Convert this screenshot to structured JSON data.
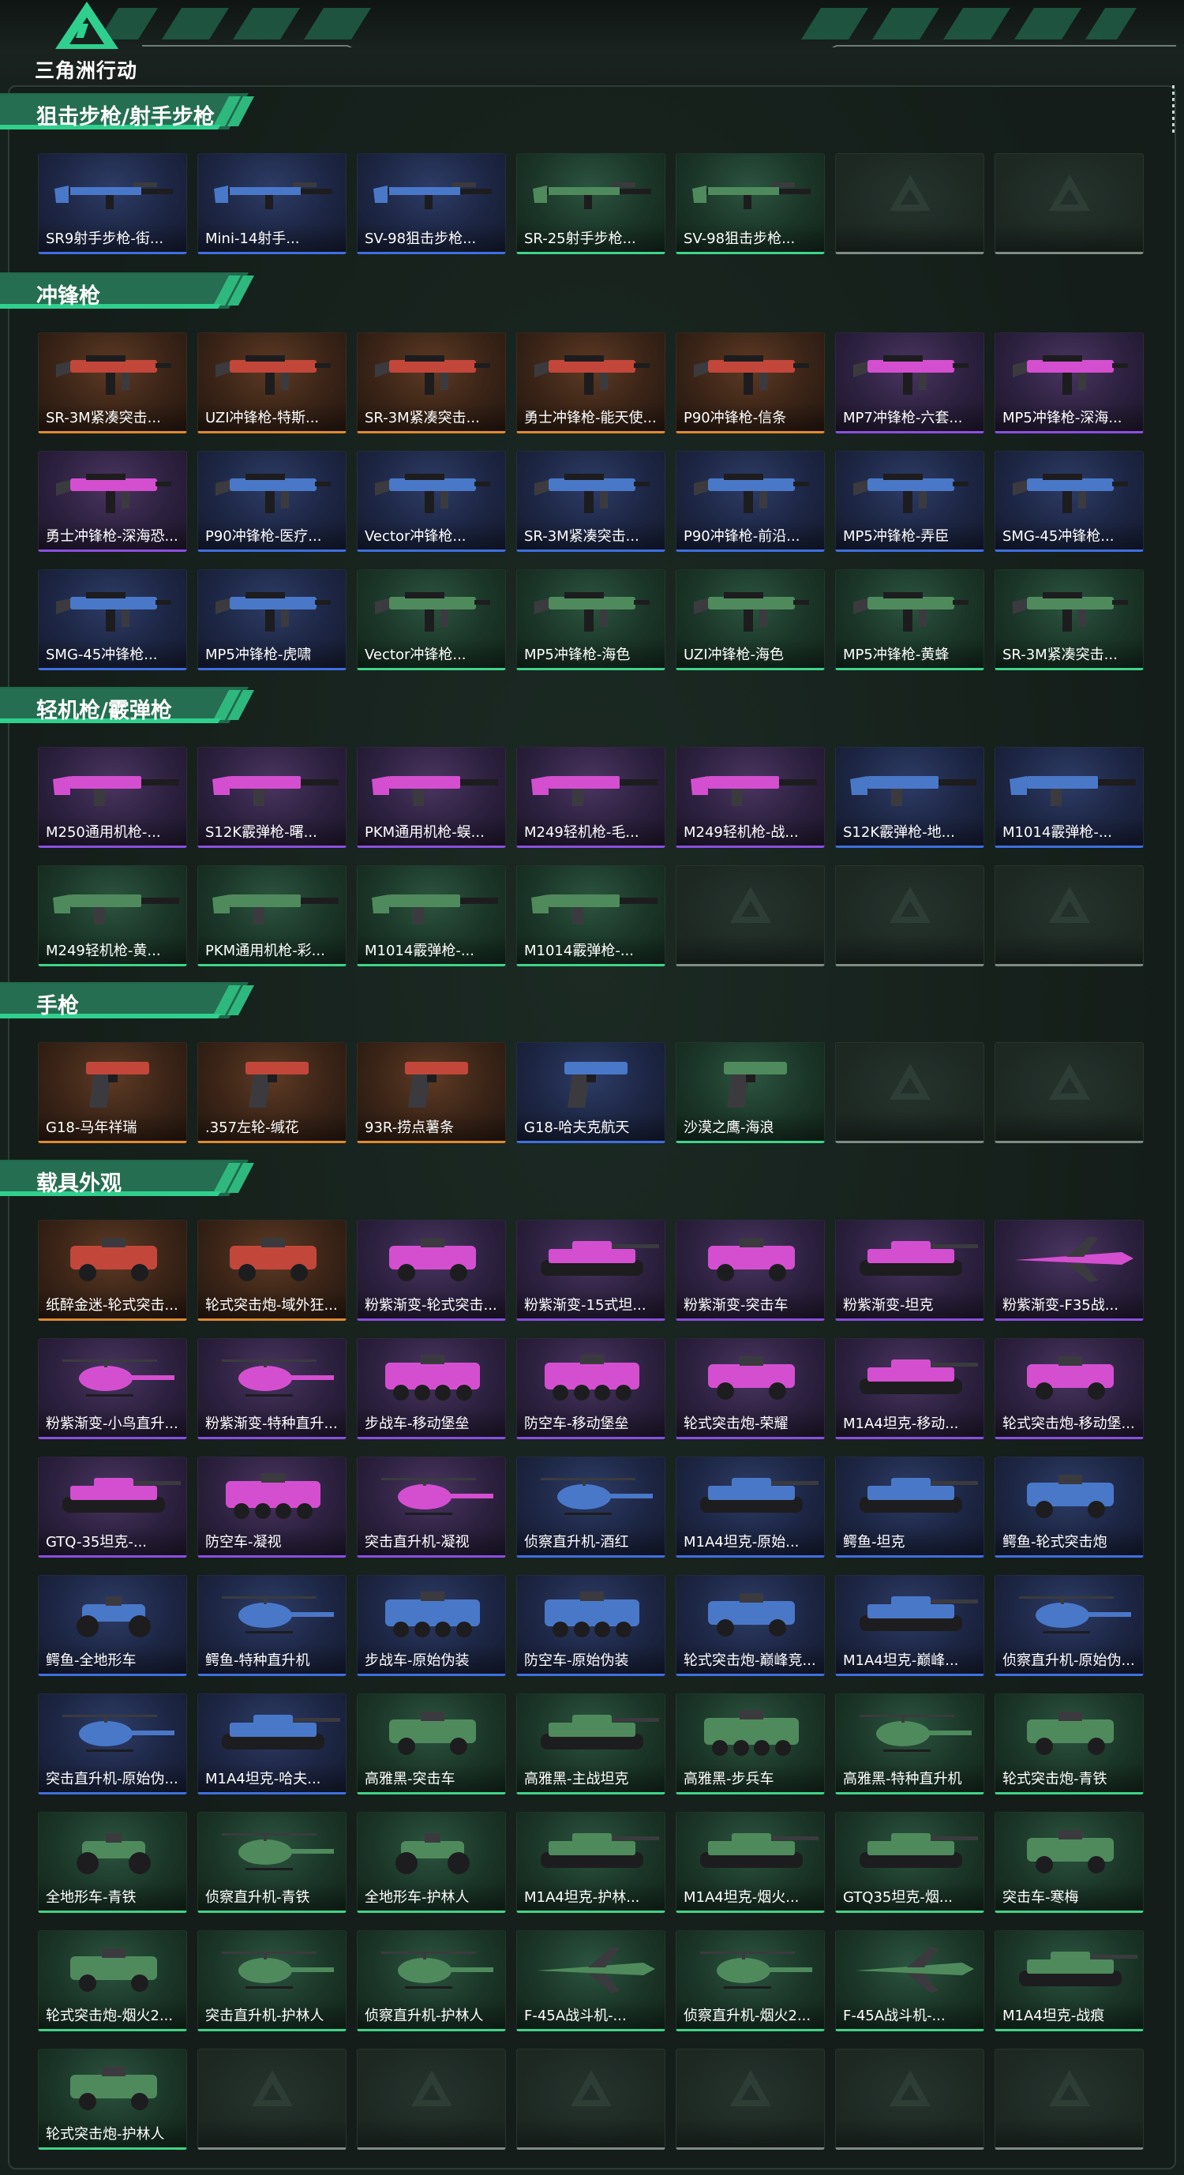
{
  "logo_text": "三角洲行动",
  "rarity_colors": {
    "gold": "#e08a2e",
    "purple": "#8b4fe0",
    "blue": "#3f6fe0",
    "green": "#3fd48a",
    "empty": "#7f8c86"
  },
  "sections": [
    {
      "title": "狙击步枪/射手步枪",
      "items": [
        {
          "label": "SR9射手步枪-街...",
          "rarity": "blue",
          "icon": "rifle-icon"
        },
        {
          "label": "Mini-14射手...",
          "rarity": "blue",
          "icon": "rifle-icon"
        },
        {
          "label": "SV-98狙击步枪...",
          "rarity": "blue",
          "icon": "sniper-rifle-icon"
        },
        {
          "label": "SR-25射手步枪...",
          "rarity": "green",
          "icon": "rifle-icon"
        },
        {
          "label": "SV-98狙击步枪...",
          "rarity": "green",
          "icon": "sniper-rifle-icon"
        },
        {
          "label": "",
          "rarity": "empty",
          "icon": "empty-slot-icon"
        },
        {
          "label": "",
          "rarity": "empty",
          "icon": "empty-slot-icon"
        }
      ]
    },
    {
      "title": "冲锋枪",
      "items": [
        {
          "label": "SR-3M紧凑突击...",
          "rarity": "gold",
          "icon": "smg-icon"
        },
        {
          "label": "UZI冲锋枪-特斯...",
          "rarity": "gold",
          "icon": "smg-icon"
        },
        {
          "label": "SR-3M紧凑突击...",
          "rarity": "gold",
          "icon": "smg-icon"
        },
        {
          "label": "勇士冲锋枪-能天使...",
          "rarity": "gold",
          "icon": "smg-icon"
        },
        {
          "label": "P90冲锋枪-信条",
          "rarity": "gold",
          "icon": "smg-icon"
        },
        {
          "label": "MP7冲锋枪-六套...",
          "rarity": "purple",
          "icon": "smg-icon"
        },
        {
          "label": "MP5冲锋枪-深海...",
          "rarity": "purple",
          "icon": "smg-icon"
        },
        {
          "label": "勇士冲锋枪-深海恐...",
          "rarity": "purple",
          "icon": "smg-icon"
        },
        {
          "label": "P90冲锋枪-医疗...",
          "rarity": "blue",
          "icon": "smg-icon"
        },
        {
          "label": "Vector冲锋枪...",
          "rarity": "blue",
          "icon": "smg-icon"
        },
        {
          "label": "SR-3M紧凑突击...",
          "rarity": "blue",
          "icon": "smg-icon"
        },
        {
          "label": "P90冲锋枪-前沿...",
          "rarity": "blue",
          "icon": "smg-icon"
        },
        {
          "label": "MP5冲锋枪-弄臣",
          "rarity": "blue",
          "icon": "smg-icon"
        },
        {
          "label": "SMG-45冲锋枪...",
          "rarity": "blue",
          "icon": "smg-icon"
        },
        {
          "label": "SMG-45冲锋枪...",
          "rarity": "blue",
          "icon": "smg-icon"
        },
        {
          "label": "MP5冲锋枪-虎啸",
          "rarity": "blue",
          "icon": "smg-icon"
        },
        {
          "label": "Vector冲锋枪...",
          "rarity": "green",
          "icon": "smg-icon"
        },
        {
          "label": "MP5冲锋枪-海色",
          "rarity": "green",
          "icon": "smg-icon"
        },
        {
          "label": "UZI冲锋枪-海色",
          "rarity": "green",
          "icon": "smg-icon"
        },
        {
          "label": "MP5冲锋枪-黄蜂",
          "rarity": "green",
          "icon": "smg-icon"
        },
        {
          "label": "SR-3M紧凑突击...",
          "rarity": "green",
          "icon": "smg-icon"
        }
      ]
    },
    {
      "title": "轻机枪/霰弹枪",
      "items": [
        {
          "label": "M250通用机枪-...",
          "rarity": "purple",
          "icon": "machine-gun-icon"
        },
        {
          "label": "S12K霰弹枪-曙...",
          "rarity": "purple",
          "icon": "shotgun-icon"
        },
        {
          "label": "PKM通用机枪-蜈...",
          "rarity": "purple",
          "icon": "machine-gun-icon"
        },
        {
          "label": "M249轻机枪-毛...",
          "rarity": "purple",
          "icon": "machine-gun-icon"
        },
        {
          "label": "M249轻机枪-战...",
          "rarity": "purple",
          "icon": "machine-gun-icon"
        },
        {
          "label": "S12K霰弹枪-地...",
          "rarity": "blue",
          "icon": "shotgun-icon"
        },
        {
          "label": "M1014霰弹枪-...",
          "rarity": "blue",
          "icon": "shotgun-icon"
        },
        {
          "label": "M249轻机枪-黄...",
          "rarity": "green",
          "icon": "machine-gun-icon"
        },
        {
          "label": "PKM通用机枪-彩...",
          "rarity": "green",
          "icon": "machine-gun-icon"
        },
        {
          "label": "M1014霰弹枪-...",
          "rarity": "green",
          "icon": "shotgun-icon"
        },
        {
          "label": "M1014霰弹枪-...",
          "rarity": "green",
          "icon": "shotgun-icon"
        },
        {
          "label": "",
          "rarity": "empty",
          "icon": "empty-slot-icon"
        },
        {
          "label": "",
          "rarity": "empty",
          "icon": "empty-slot-icon"
        },
        {
          "label": "",
          "rarity": "empty",
          "icon": "empty-slot-icon"
        }
      ]
    },
    {
      "title": "手枪",
      "items": [
        {
          "label": "G18-马年祥瑞",
          "rarity": "gold",
          "icon": "pistol-icon"
        },
        {
          "label": ".357左轮-缄花",
          "rarity": "gold",
          "icon": "revolver-icon"
        },
        {
          "label": "93R-捞点薯条",
          "rarity": "gold",
          "icon": "pistol-icon"
        },
        {
          "label": "G18-哈夫克航天",
          "rarity": "blue",
          "icon": "pistol-icon"
        },
        {
          "label": "沙漠之鹰-海浪",
          "rarity": "green",
          "icon": "pistol-icon"
        },
        {
          "label": "",
          "rarity": "empty",
          "icon": "empty-slot-icon"
        },
        {
          "label": "",
          "rarity": "empty",
          "icon": "empty-slot-icon"
        }
      ]
    },
    {
      "title": "载具外观",
      "items": [
        {
          "label": "纸醉金迷-轮式突击...",
          "rarity": "gold",
          "icon": "armored-car-icon"
        },
        {
          "label": "轮式突击炮-域外狂...",
          "rarity": "gold",
          "icon": "armored-car-icon"
        },
        {
          "label": "粉紫渐变-轮式突击...",
          "rarity": "purple",
          "icon": "armored-car-icon"
        },
        {
          "label": "粉紫渐变-15式坦...",
          "rarity": "purple",
          "icon": "tank-icon"
        },
        {
          "label": "粉紫渐变-突击车",
          "rarity": "purple",
          "icon": "armored-car-icon"
        },
        {
          "label": "粉紫渐变-坦克",
          "rarity": "purple",
          "icon": "tank-icon"
        },
        {
          "label": "粉紫渐变-F35战...",
          "rarity": "purple",
          "icon": "jet-icon"
        },
        {
          "label": "粉紫渐变-小鸟直升...",
          "rarity": "purple",
          "icon": "helicopter-icon"
        },
        {
          "label": "粉紫渐变-特种直升...",
          "rarity": "purple",
          "icon": "helicopter-icon"
        },
        {
          "label": "步战车-移动堡垒",
          "rarity": "purple",
          "icon": "apc-icon"
        },
        {
          "label": "防空车-移动堡垒",
          "rarity": "purple",
          "icon": "apc-icon"
        },
        {
          "label": "轮式突击炮-荣耀",
          "rarity": "purple",
          "icon": "armored-car-icon"
        },
        {
          "label": "M1A4坦克-移动...",
          "rarity": "purple",
          "icon": "tank-icon"
        },
        {
          "label": "轮式突击炮-移动堡...",
          "rarity": "purple",
          "icon": "armored-car-icon"
        },
        {
          "label": "GTQ-35坦克-...",
          "rarity": "purple",
          "icon": "tank-icon"
        },
        {
          "label": "防空车-凝视",
          "rarity": "purple",
          "icon": "apc-icon"
        },
        {
          "label": "突击直升机-凝视",
          "rarity": "purple",
          "icon": "helicopter-icon"
        },
        {
          "label": "侦察直升机-酒红",
          "rarity": "blue",
          "icon": "helicopter-icon"
        },
        {
          "label": "M1A4坦克-原始...",
          "rarity": "blue",
          "icon": "tank-icon"
        },
        {
          "label": "鳄鱼-坦克",
          "rarity": "blue",
          "icon": "tank-icon"
        },
        {
          "label": "鳄鱼-轮式突击炮",
          "rarity": "blue",
          "icon": "armored-car-icon"
        },
        {
          "label": "鳄鱼-全地形车",
          "rarity": "blue",
          "icon": "atv-icon"
        },
        {
          "label": "鳄鱼-特种直升机",
          "rarity": "blue",
          "icon": "helicopter-icon"
        },
        {
          "label": "步战车-原始伪装",
          "rarity": "blue",
          "icon": "apc-icon"
        },
        {
          "label": "防空车-原始伪装",
          "rarity": "blue",
          "icon": "apc-icon"
        },
        {
          "label": "轮式突击炮-巅峰竞...",
          "rarity": "blue",
          "icon": "armored-car-icon"
        },
        {
          "label": "M1A4坦克-巅峰...",
          "rarity": "blue",
          "icon": "tank-icon"
        },
        {
          "label": "侦察直升机-原始伪...",
          "rarity": "blue",
          "icon": "helicopter-icon"
        },
        {
          "label": "突击直升机-原始伪...",
          "rarity": "blue",
          "icon": "helicopter-icon"
        },
        {
          "label": "M1A4坦克-哈夫...",
          "rarity": "blue",
          "icon": "tank-icon"
        },
        {
          "label": "高雅黑-突击车",
          "rarity": "green",
          "icon": "armored-car-icon"
        },
        {
          "label": "高雅黑-主战坦克",
          "rarity": "green",
          "icon": "tank-icon"
        },
        {
          "label": "高雅黑-步兵车",
          "rarity": "green",
          "icon": "apc-icon"
        },
        {
          "label": "高雅黑-特种直升机",
          "rarity": "green",
          "icon": "helicopter-icon"
        },
        {
          "label": "轮式突击炮-青铁",
          "rarity": "green",
          "icon": "armored-car-icon"
        },
        {
          "label": "全地形车-青铁",
          "rarity": "green",
          "icon": "atv-icon"
        },
        {
          "label": "侦察直升机-青铁",
          "rarity": "green",
          "icon": "helicopter-icon"
        },
        {
          "label": "全地形车-护林人",
          "rarity": "green",
          "icon": "atv-icon"
        },
        {
          "label": "M1A4坦克-护林...",
          "rarity": "green",
          "icon": "tank-icon"
        },
        {
          "label": "M1A4坦克-烟火...",
          "rarity": "green",
          "icon": "tank-icon"
        },
        {
          "label": "GTQ35坦克-烟...",
          "rarity": "green",
          "icon": "tank-icon"
        },
        {
          "label": "突击车-寒梅",
          "rarity": "green",
          "icon": "armored-car-icon"
        },
        {
          "label": "轮式突击炮-烟火2...",
          "rarity": "green",
          "icon": "armored-car-icon"
        },
        {
          "label": "突击直升机-护林人",
          "rarity": "green",
          "icon": "helicopter-icon"
        },
        {
          "label": "侦察直升机-护林人",
          "rarity": "green",
          "icon": "helicopter-icon"
        },
        {
          "label": "F-45A战斗机-...",
          "rarity": "green",
          "icon": "jet-icon"
        },
        {
          "label": "侦察直升机-烟火2...",
          "rarity": "green",
          "icon": "helicopter-icon"
        },
        {
          "label": "F-45A战斗机-...",
          "rarity": "green",
          "icon": "jet-icon"
        },
        {
          "label": "M1A4坦克-战痕",
          "rarity": "green",
          "icon": "tank-icon"
        },
        {
          "label": "轮式突击炮-护林人",
          "rarity": "green",
          "icon": "armored-car-icon"
        },
        {
          "label": "",
          "rarity": "empty",
          "icon": "empty-slot-icon"
        },
        {
          "label": "",
          "rarity": "empty",
          "icon": "empty-slot-icon"
        },
        {
          "label": "",
          "rarity": "empty",
          "icon": "empty-slot-icon"
        },
        {
          "label": "",
          "rarity": "empty",
          "icon": "empty-slot-icon"
        },
        {
          "label": "",
          "rarity": "empty",
          "icon": "empty-slot-icon"
        },
        {
          "label": "",
          "rarity": "empty",
          "icon": "empty-slot-icon"
        }
      ]
    }
  ]
}
